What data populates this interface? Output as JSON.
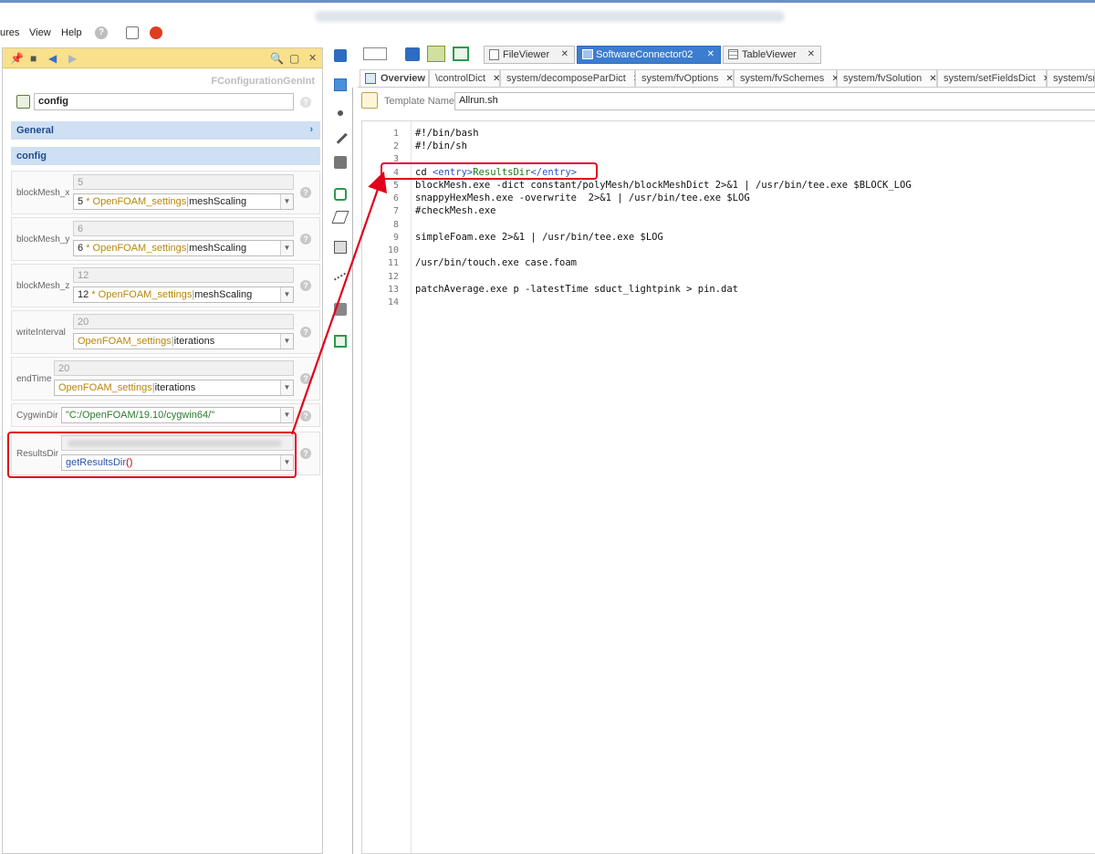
{
  "menubar": {
    "items": [
      "ures",
      "View",
      "Help"
    ]
  },
  "leftpanel": {
    "subtitle": "FConfigurationGenInt",
    "config_name": "config",
    "sections": {
      "general": "General",
      "config": "config"
    },
    "params": [
      {
        "label": "blockMesh_x",
        "value": "5",
        "prefix": "5",
        "op": "*",
        "ref": "OpenFOAM_settings",
        "sep": "|",
        "member": "meshScaling"
      },
      {
        "label": "blockMesh_y",
        "value": "6",
        "prefix": "6",
        "op": "*",
        "ref": "OpenFOAM_settings",
        "sep": "|",
        "member": "meshScaling"
      },
      {
        "label": "blockMesh_z",
        "value": "12",
        "prefix": "12",
        "op": "*",
        "ref": "OpenFOAM_settings",
        "sep": "|",
        "member": "meshScaling"
      },
      {
        "label": "writeInterval",
        "value": "20",
        "ref": "OpenFOAM_settings",
        "sep": "|",
        "member": "iterations"
      },
      {
        "label": "endTime",
        "value": "20",
        "ref": "OpenFOAM_settings",
        "sep": "|",
        "member": "iterations"
      },
      {
        "label": "CygwinDir",
        "expr": "\"C:/OpenFOAM/19.10/cygwin64/\""
      },
      {
        "label": "ResultsDir",
        "expr_fn": "getResultsDir",
        "expr_parens": "()"
      }
    ]
  },
  "editor_tabs": [
    {
      "label": "FileViewer"
    },
    {
      "label": "SoftwareConnector02",
      "active": true
    },
    {
      "label": "TableViewer"
    }
  ],
  "sub_tabs": [
    "Overview",
    "\\controlDict",
    "system/decomposeParDict",
    "system/fvOptions",
    "system/fvSchemes",
    "system/fvSolution",
    "system/setFieldsDict",
    "system/sn"
  ],
  "template": {
    "label": "Template Name",
    "value": "Allrun.sh"
  },
  "code": {
    "line_numbers": [
      "1",
      "2",
      "3",
      "4",
      "5",
      "6",
      "7",
      "8",
      "9",
      "10",
      "11",
      "12",
      "13",
      "14"
    ],
    "lines": [
      "#!/bin/bash",
      "#!/bin/sh",
      "",
      "",
      "blockMesh.exe -dict constant/polyMesh/blockMeshDict 2>&1 | /usr/bin/tee.exe $BLOCK_LOG",
      "snappyHexMesh.exe -overwrite  2>&1 | /usr/bin/tee.exe $LOG",
      "#checkMesh.exe",
      "",
      "simpleFoam.exe 2>&1 | /usr/bin/tee.exe $LOG",
      "",
      "/usr/bin/touch.exe case.foam",
      "",
      "patchAverage.exe p -latestTime sduct_lightpink > pin.dat",
      ""
    ],
    "line4": {
      "cmd": "cd ",
      "open_tag": "<entry>",
      "entry": "ResultsDir",
      "close_tag": "</entry>"
    }
  },
  "colors": {
    "highlight_red": "#e2001a",
    "panel_toolbar": "#f9e08a",
    "section_bg": "#cfe0f4"
  },
  "icons": [
    "pin-icon",
    "menu-icon",
    "back-icon",
    "forward-icon",
    "search-icon",
    "restore-icon",
    "close-icon",
    "help-icon",
    "clone-icon",
    "stop-icon"
  ]
}
